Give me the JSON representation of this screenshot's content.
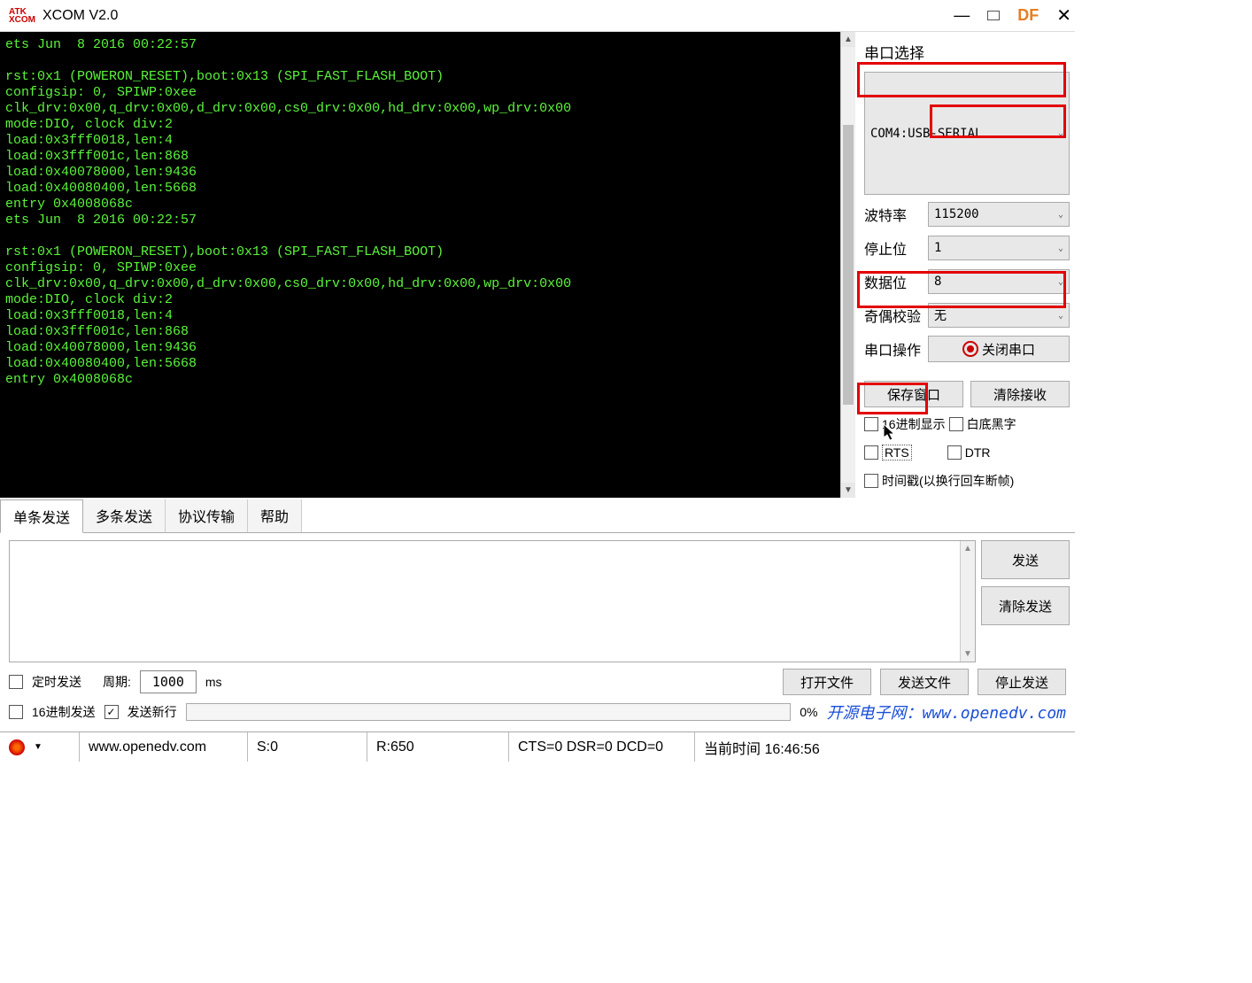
{
  "title": "XCOM V2.0",
  "logo": {
    "l1": "ATK",
    "l2": "XCOM"
  },
  "winctrl": {
    "df": "DF"
  },
  "terminal": "ets Jun  8 2016 00:22:57\n\nrst:0x1 (POWERON_RESET),boot:0x13 (SPI_FAST_FLASH_BOOT)\nconfigsip: 0, SPIWP:0xee\nclk_drv:0x00,q_drv:0x00,d_drv:0x00,cs0_drv:0x00,hd_drv:0x00,wp_drv:0x00\nmode:DIO, clock div:2\nload:0x3fff0018,len:4\nload:0x3fff001c,len:868\nload:0x40078000,len:9436\nload:0x40080400,len:5668\nentry 0x4008068c\nets Jun  8 2016 00:22:57\n\nrst:0x1 (POWERON_RESET),boot:0x13 (SPI_FAST_FLASH_BOOT)\nconfigsip: 0, SPIWP:0xee\nclk_drv:0x00,q_drv:0x00,d_drv:0x00,cs0_drv:0x00,hd_drv:0x00,wp_drv:0x00\nmode:DIO, clock div:2\nload:0x3fff0018,len:4\nload:0x3fff001c,len:868\nload:0x40078000,len:9436\nload:0x40080400,len:5668\nentry 0x4008068c",
  "side": {
    "title": "串口选择",
    "port": "COM4:USB-SERIAL",
    "baud_label": "波特率",
    "baud": "115200",
    "stop_label": "停止位",
    "stop": "1",
    "data_label": "数据位",
    "data": "8",
    "parity_label": "奇偶校验",
    "parity": "无",
    "op_label": "串口操作",
    "op_btn": "关闭串口",
    "save_btn": "保存窗口",
    "clear_btn": "清除接收",
    "hex_disp": "16进制显示",
    "white_bg": "白底黑字",
    "rts": "RTS",
    "dtr": "DTR",
    "ts": "时间戳(以换行回车断帧)"
  },
  "tabs": [
    "单条发送",
    "多条发送",
    "协议传输",
    "帮助"
  ],
  "send": {
    "send_btn": "发送",
    "clear_send_btn": "清除发送"
  },
  "opts": {
    "timed": "定时发送",
    "period_label": "周期:",
    "period": "1000",
    "ms": "ms",
    "open_file": "打开文件",
    "send_file": "发送文件",
    "stop_send": "停止发送",
    "hex_send": "16进制发送",
    "newline": "发送新行",
    "pct": "0%",
    "link_text": "开源电子网：",
    "link_url": "www.openedv.com"
  },
  "status": {
    "url": "www.openedv.com",
    "s": "S:0",
    "r": "R:650",
    "flags": "CTS=0 DSR=0 DCD=0",
    "time_label": "当前时间 16:46:56"
  }
}
